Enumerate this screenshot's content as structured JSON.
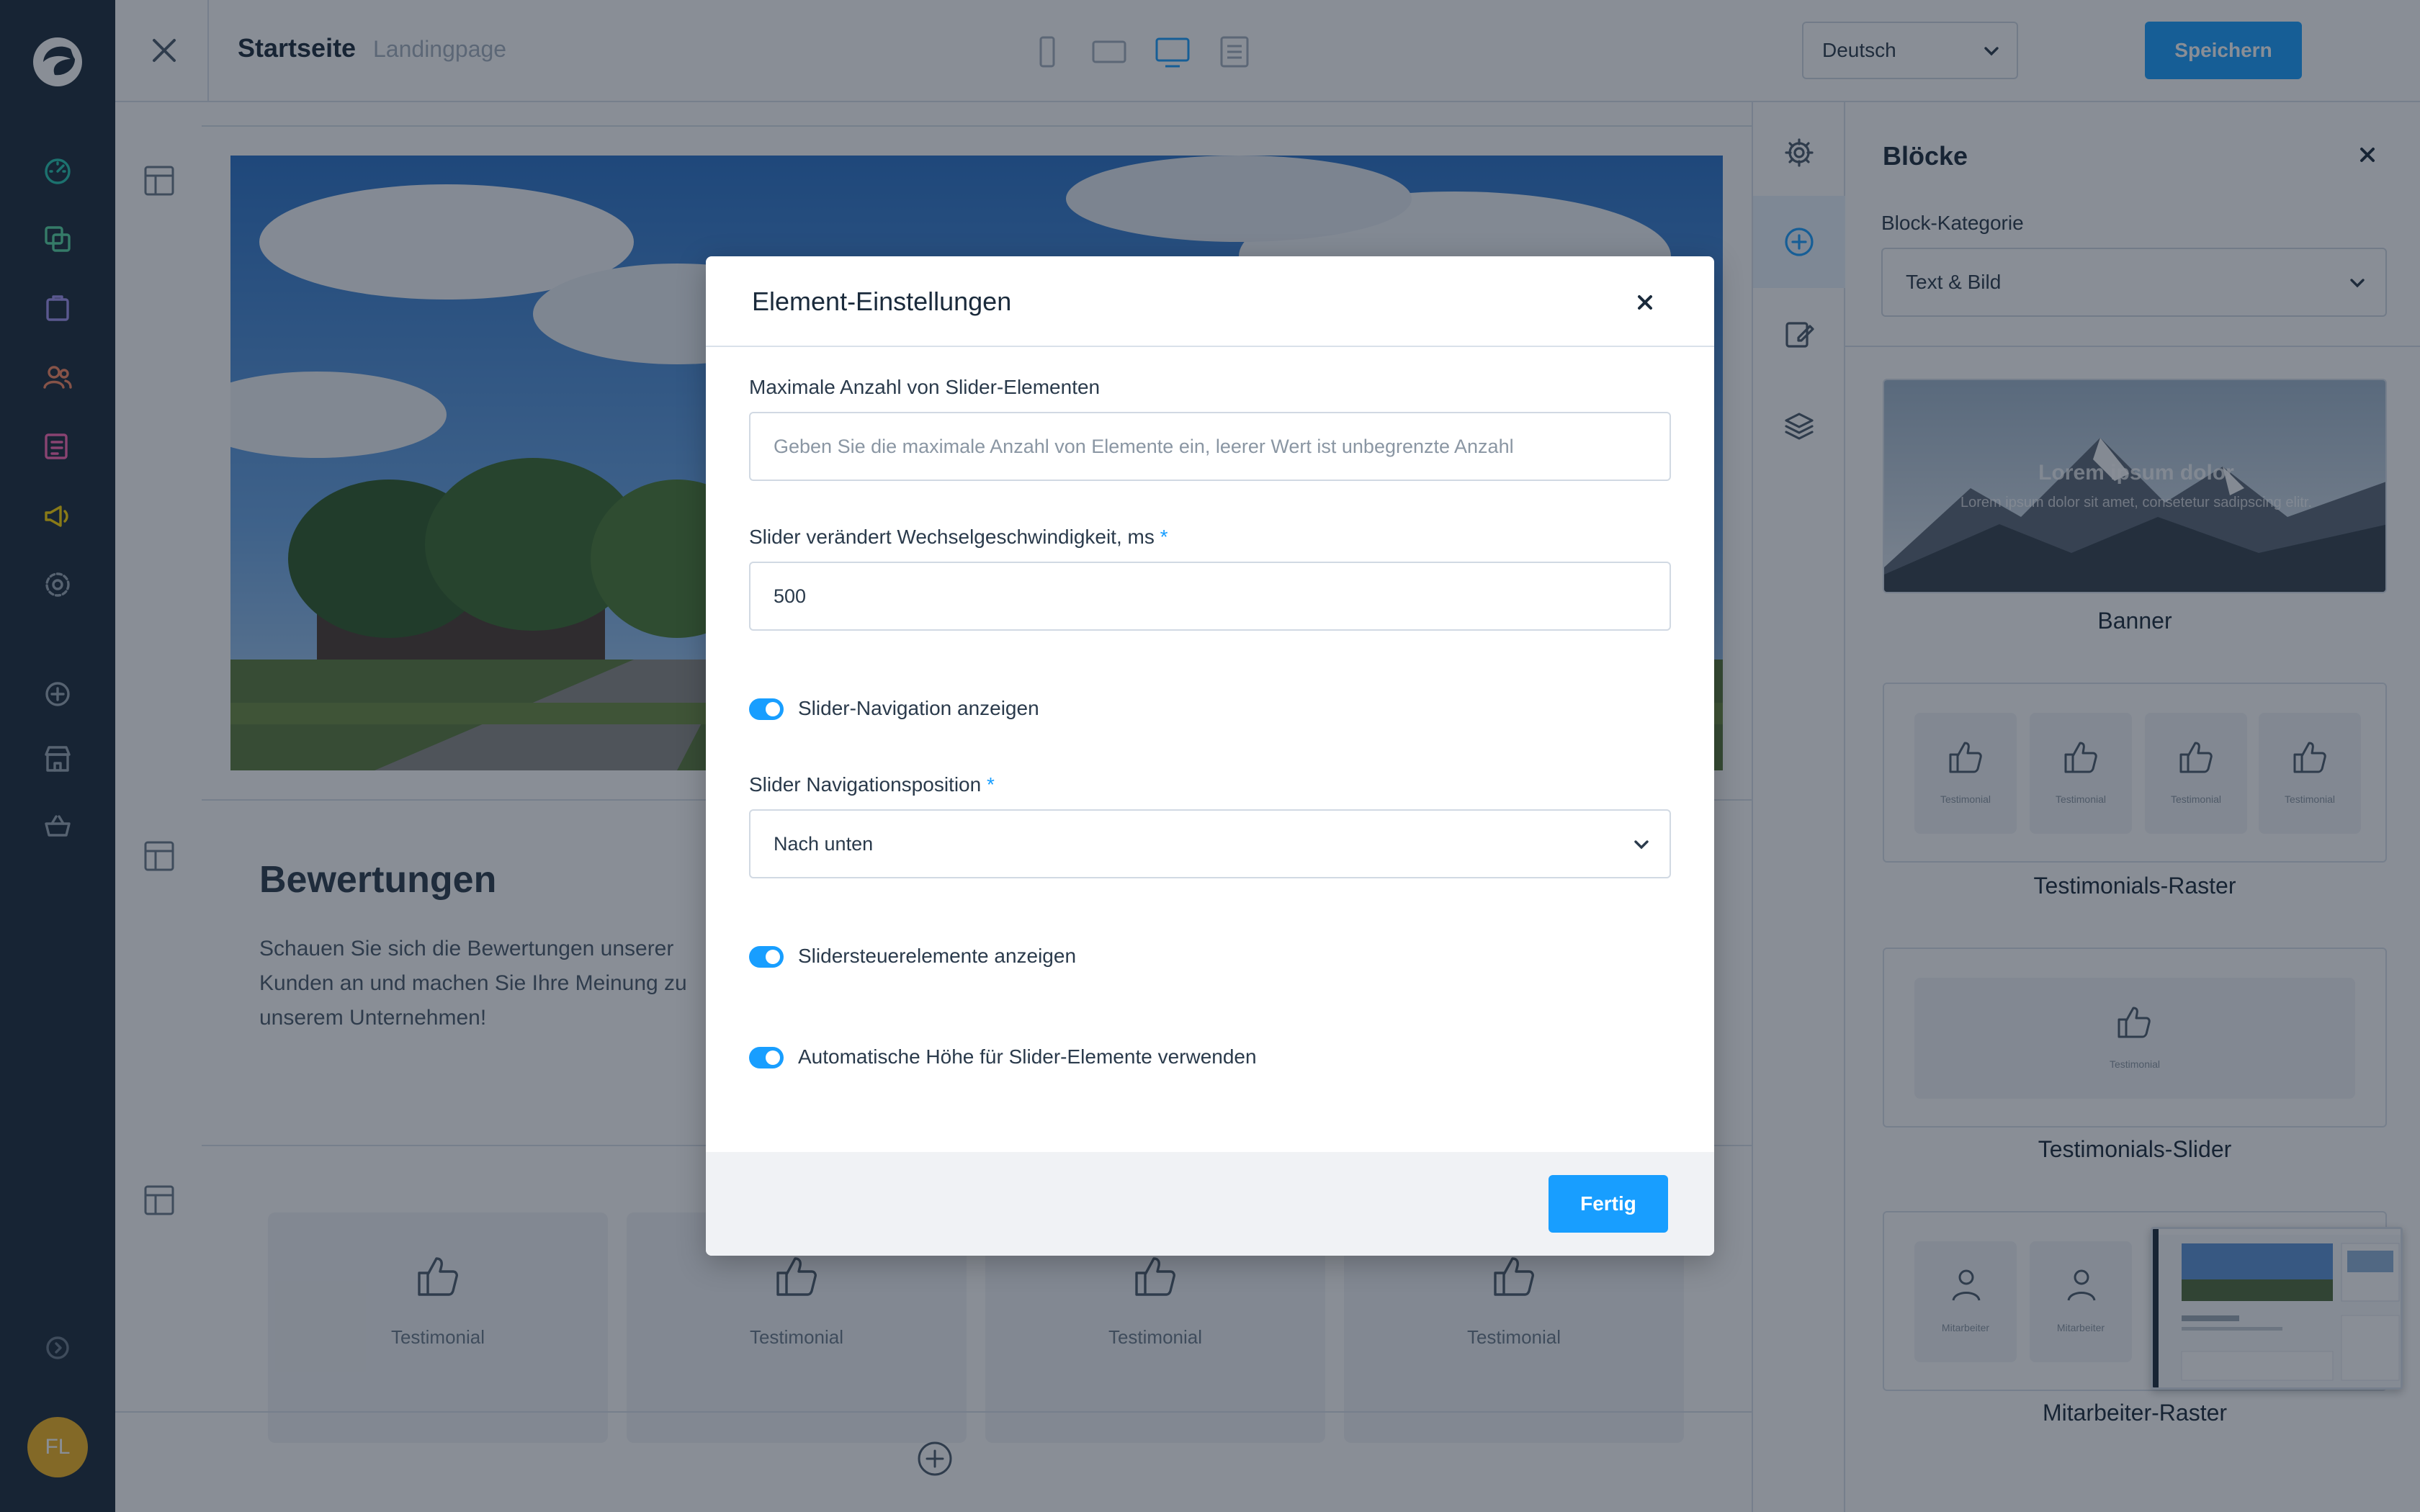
{
  "app": {
    "brand_color": "#189eff",
    "sidebar_color": "#1a2a3b"
  },
  "topbar": {
    "title": "Startseite",
    "page_type": "Landingpage",
    "language": "Deutsch",
    "save_label": "Speichern",
    "viewports": [
      "mobile-icon",
      "tablet-icon",
      "desktop-icon",
      "list-icon"
    ],
    "active_viewport": "desktop-icon"
  },
  "leftnav": {
    "items": [
      "dashboard-icon",
      "catalogues-icon",
      "orders-icon",
      "customers-icon",
      "content-icon",
      "marketing-icon",
      "settings-icon",
      "add-icon",
      "sales-channel-icon",
      "basket-icon"
    ],
    "user_initials": "FL"
  },
  "canvas": {
    "rating_title": "Bewertungen",
    "rating_text": "Schauen Sie sich die Bewertungen unserer Kunden an und machen Sie Ihre Meinung zu unserem Unternehmen!",
    "testimonials": [
      "Testimonial",
      "Testimonial",
      "Testimonial",
      "Testimonial"
    ]
  },
  "rail": {
    "items": [
      "settings-icon",
      "add-block-icon",
      "edit-icon",
      "layers-icon"
    ],
    "active": "add-block-icon"
  },
  "blocks_panel": {
    "title": "Blöcke",
    "category_label": "Block-Kategorie",
    "category_value": "Text & Bild",
    "banner_preview_title": "Lorem ipsum dolor",
    "banner_preview_text": "Lorem ipsum dolor sit amet, consetetur sadipscing elitr.",
    "blocks": [
      {
        "name": "Banner"
      },
      {
        "name": "Testimonials-Raster",
        "items": [
          "Testimonial",
          "Testimonial",
          "Testimonial",
          "Testimonial"
        ]
      },
      {
        "name": "Testimonials-Slider",
        "items": [
          "Testimonial"
        ]
      },
      {
        "name": "Mitarbeiter-Raster",
        "items": [
          "Mitarbeiter",
          "Mitarbeiter"
        ]
      }
    ]
  },
  "modal": {
    "title": "Element-Einstellungen",
    "max_items_label": "Maximale Anzahl von Slider-Elementen",
    "max_items_placeholder": "Geben Sie die maximale Anzahl von Elemente ein, leerer Wert ist unbegrenzte Anzahl",
    "speed_label": "Slider verändert Wechselgeschwindigkeit, ms",
    "speed_required": "*",
    "speed_value": "500",
    "nav_toggle_label": "Slider-Navigation anzeigen",
    "nav_toggle_on": true,
    "nav_position_label": "Slider Navigationsposition",
    "nav_position_required": "*",
    "nav_position_value": "Nach unten",
    "controls_toggle_label": "Slidersteuerelemente anzeigen",
    "controls_toggle_on": true,
    "autoheight_toggle_label": "Automatische Höhe für Slider-Elemente verwenden",
    "autoheight_toggle_on": true,
    "done_label": "Fertig"
  }
}
